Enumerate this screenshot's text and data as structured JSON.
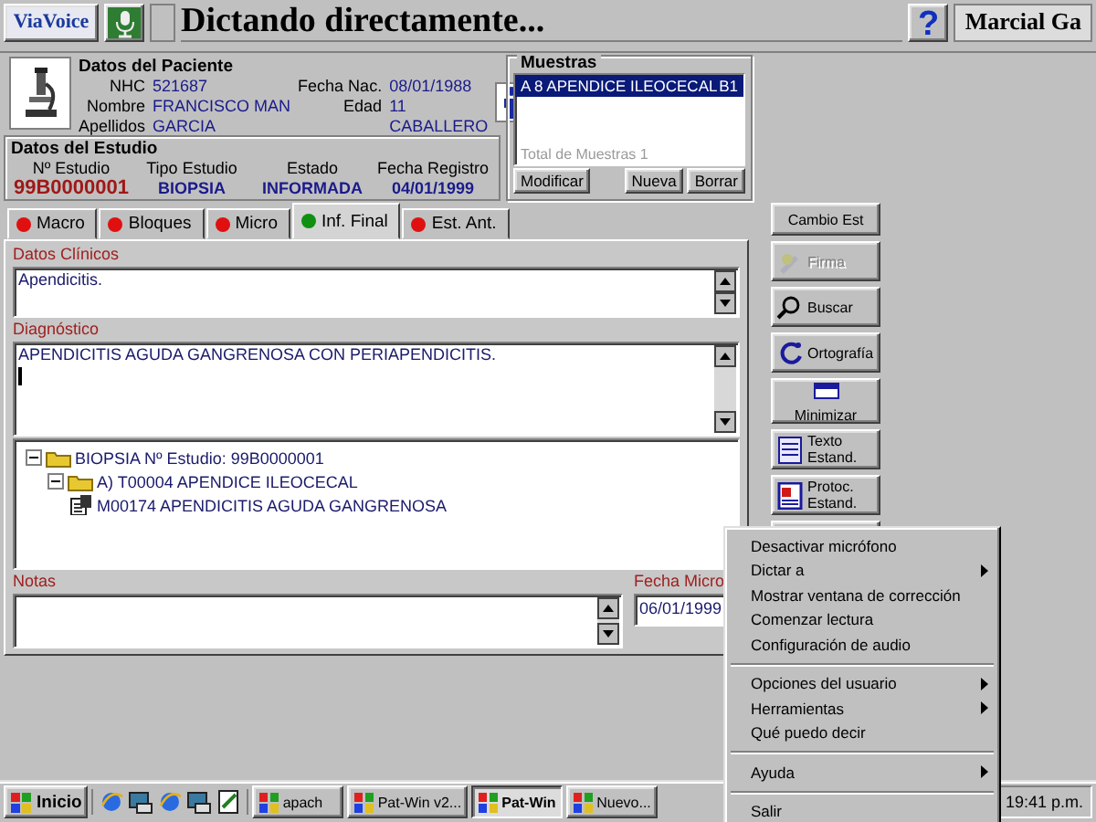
{
  "toolbar": {
    "logo": "ViaVoice",
    "title": "Dictando directamente...",
    "help": "?",
    "user": "Marcial Ga"
  },
  "patient": {
    "heading": "Datos del Paciente",
    "fields": [
      {
        "label": "NHC",
        "value": "521687"
      },
      {
        "label": "Fecha Nac.",
        "value": "08/01/1988"
      },
      {
        "label": "Nombre",
        "value": "FRANCISCO MAN"
      },
      {
        "label": "Edad",
        "value": "11"
      },
      {
        "label": "Apellidos",
        "value": "GARCIA"
      },
      {
        "value": "CABALLERO"
      }
    ]
  },
  "study": {
    "heading": "Datos del Estudio",
    "fields": [
      {
        "label": "Nº Estudio",
        "value": "99B0000001"
      },
      {
        "label": "Tipo Estudio",
        "value": "BIOPSIA"
      },
      {
        "label": "Estado",
        "value": "INFORMADA"
      },
      {
        "label": "Fecha Registro",
        "value": "04/01/1999"
      }
    ]
  },
  "samples": {
    "heading": "Muestras",
    "items": [
      {
        "name": "A 8 APENDICE ILEOCECAL",
        "code": "B1",
        "selected": true
      }
    ],
    "total_label": "Total de Muestras",
    "total": "1",
    "buttons": [
      "Modificar",
      "Nueva",
      "Borrar"
    ]
  },
  "tabs": [
    {
      "label": "Macro",
      "color": "#e01010",
      "selected": false
    },
    {
      "label": "Bloques",
      "color": "#e01010",
      "selected": false
    },
    {
      "label": "Micro",
      "color": "#e01010",
      "selected": false
    },
    {
      "label": "Inf. Final",
      "color": "#109010",
      "selected": true
    },
    {
      "label": "Est. Ant.",
      "color": "#e01010",
      "selected": false
    }
  ],
  "clinical": {
    "label": "Datos Clínicos",
    "value": "Apendicitis."
  },
  "diagnosis": {
    "label": "Diagnóstico",
    "value": "APENDICITIS AGUDA GANGRENOSA CON PERIAPENDICITIS."
  },
  "tree": [
    {
      "label": "BIOPSIA  Nº Estudio: 99B0000001",
      "kind": "folder",
      "expanded": true,
      "children": [
        {
          "label": "A) T00004 APENDICE ILEOCECAL",
          "kind": "folder",
          "expanded": true,
          "children": [
            {
              "label": "M00174 APENDICITIS AGUDA GANGRENOSA",
              "kind": "diagnosis"
            }
          ]
        }
      ]
    }
  ],
  "notes": {
    "label": "Notas"
  },
  "micro_date": {
    "label": "Fecha Micro",
    "value": "06/01/1999"
  },
  "side_buttons": [
    {
      "kind": "text",
      "label": "Cambio Est",
      "disabled": false
    },
    {
      "kind": "sign",
      "label": "Firma",
      "disabled": true
    },
    {
      "kind": "search",
      "label": "Buscar",
      "disabled": false
    },
    {
      "kind": "spell",
      "label": "Ortografía",
      "disabled": false
    },
    {
      "kind": "minimize",
      "label": "Minimizar",
      "disabled": false
    },
    {
      "kind": "template",
      "label": "Texto Estand.",
      "disabled": false
    },
    {
      "kind": "protocol",
      "label": "Protoc. Estand.",
      "disabled": false
    },
    {
      "kind": "partial"
    }
  ],
  "context_menu": {
    "items": [
      {
        "kind": "item",
        "label": "Desactivar micrófono",
        "submenu": false
      },
      {
        "kind": "item",
        "label": "Dictar a",
        "submenu": true
      },
      {
        "kind": "item",
        "label": "Mostrar ventana de corrección",
        "submenu": false
      },
      {
        "kind": "item",
        "label": "Comenzar lectura",
        "submenu": false
      },
      {
        "kind": "item",
        "label": "Configuración de audio",
        "submenu": false
      },
      {
        "kind": "separator"
      },
      {
        "kind": "item",
        "label": "Opciones del usuario",
        "submenu": true
      },
      {
        "kind": "item",
        "label": "Herramientas",
        "submenu": true
      },
      {
        "kind": "item",
        "label": "Qué puedo decir",
        "submenu": false
      },
      {
        "kind": "separator"
      },
      {
        "kind": "item",
        "label": "Ayuda",
        "submenu": true
      },
      {
        "kind": "separator"
      },
      {
        "kind": "item",
        "label": "Salir",
        "submenu": false
      }
    ]
  },
  "taskbar": {
    "start": "Inicio",
    "tasks": [
      {
        "label": "apach",
        "selected": false
      },
      {
        "label": "Pat-Win v2...",
        "selected": false
      },
      {
        "label": "Pat-Win",
        "selected": true
      },
      {
        "label": "Nuevo...",
        "selected": false
      }
    ],
    "clock": "19:41 p.m."
  }
}
